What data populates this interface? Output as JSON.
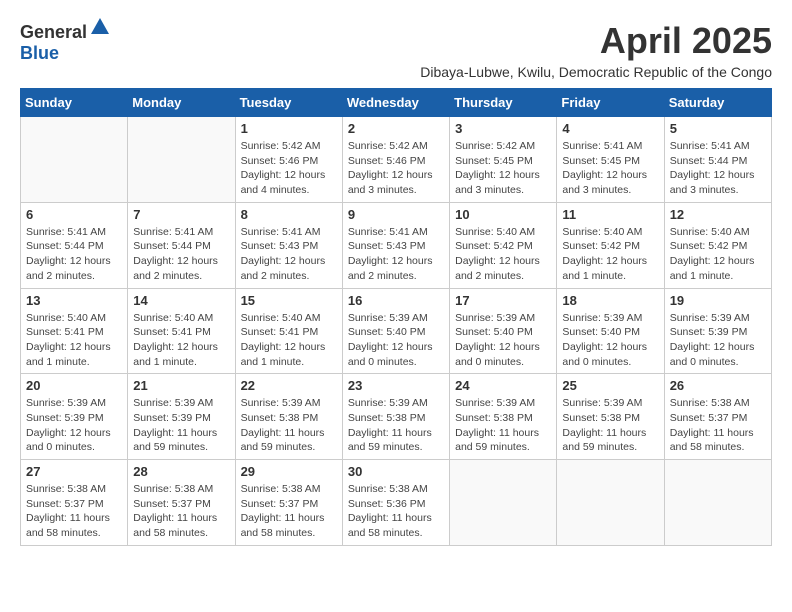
{
  "logo": {
    "general": "General",
    "blue": "Blue"
  },
  "title": {
    "month_year": "April 2025",
    "location": "Dibaya-Lubwe, Kwilu, Democratic Republic of the Congo"
  },
  "header_days": [
    "Sunday",
    "Monday",
    "Tuesday",
    "Wednesday",
    "Thursday",
    "Friday",
    "Saturday"
  ],
  "weeks": [
    [
      {
        "day": "",
        "info": ""
      },
      {
        "day": "",
        "info": ""
      },
      {
        "day": "1",
        "info": "Sunrise: 5:42 AM\nSunset: 5:46 PM\nDaylight: 12 hours\nand 4 minutes."
      },
      {
        "day": "2",
        "info": "Sunrise: 5:42 AM\nSunset: 5:46 PM\nDaylight: 12 hours\nand 3 minutes."
      },
      {
        "day": "3",
        "info": "Sunrise: 5:42 AM\nSunset: 5:45 PM\nDaylight: 12 hours\nand 3 minutes."
      },
      {
        "day": "4",
        "info": "Sunrise: 5:41 AM\nSunset: 5:45 PM\nDaylight: 12 hours\nand 3 minutes."
      },
      {
        "day": "5",
        "info": "Sunrise: 5:41 AM\nSunset: 5:44 PM\nDaylight: 12 hours\nand 3 minutes."
      }
    ],
    [
      {
        "day": "6",
        "info": "Sunrise: 5:41 AM\nSunset: 5:44 PM\nDaylight: 12 hours\nand 2 minutes."
      },
      {
        "day": "7",
        "info": "Sunrise: 5:41 AM\nSunset: 5:44 PM\nDaylight: 12 hours\nand 2 minutes."
      },
      {
        "day": "8",
        "info": "Sunrise: 5:41 AM\nSunset: 5:43 PM\nDaylight: 12 hours\nand 2 minutes."
      },
      {
        "day": "9",
        "info": "Sunrise: 5:41 AM\nSunset: 5:43 PM\nDaylight: 12 hours\nand 2 minutes."
      },
      {
        "day": "10",
        "info": "Sunrise: 5:40 AM\nSunset: 5:42 PM\nDaylight: 12 hours\nand 2 minutes."
      },
      {
        "day": "11",
        "info": "Sunrise: 5:40 AM\nSunset: 5:42 PM\nDaylight: 12 hours\nand 1 minute."
      },
      {
        "day": "12",
        "info": "Sunrise: 5:40 AM\nSunset: 5:42 PM\nDaylight: 12 hours\nand 1 minute."
      }
    ],
    [
      {
        "day": "13",
        "info": "Sunrise: 5:40 AM\nSunset: 5:41 PM\nDaylight: 12 hours\nand 1 minute."
      },
      {
        "day": "14",
        "info": "Sunrise: 5:40 AM\nSunset: 5:41 PM\nDaylight: 12 hours\nand 1 minute."
      },
      {
        "day": "15",
        "info": "Sunrise: 5:40 AM\nSunset: 5:41 PM\nDaylight: 12 hours\nand 1 minute."
      },
      {
        "day": "16",
        "info": "Sunrise: 5:39 AM\nSunset: 5:40 PM\nDaylight: 12 hours\nand 0 minutes."
      },
      {
        "day": "17",
        "info": "Sunrise: 5:39 AM\nSunset: 5:40 PM\nDaylight: 12 hours\nand 0 minutes."
      },
      {
        "day": "18",
        "info": "Sunrise: 5:39 AM\nSunset: 5:40 PM\nDaylight: 12 hours\nand 0 minutes."
      },
      {
        "day": "19",
        "info": "Sunrise: 5:39 AM\nSunset: 5:39 PM\nDaylight: 12 hours\nand 0 minutes."
      }
    ],
    [
      {
        "day": "20",
        "info": "Sunrise: 5:39 AM\nSunset: 5:39 PM\nDaylight: 12 hours\nand 0 minutes."
      },
      {
        "day": "21",
        "info": "Sunrise: 5:39 AM\nSunset: 5:39 PM\nDaylight: 11 hours\nand 59 minutes."
      },
      {
        "day": "22",
        "info": "Sunrise: 5:39 AM\nSunset: 5:38 PM\nDaylight: 11 hours\nand 59 minutes."
      },
      {
        "day": "23",
        "info": "Sunrise: 5:39 AM\nSunset: 5:38 PM\nDaylight: 11 hours\nand 59 minutes."
      },
      {
        "day": "24",
        "info": "Sunrise: 5:39 AM\nSunset: 5:38 PM\nDaylight: 11 hours\nand 59 minutes."
      },
      {
        "day": "25",
        "info": "Sunrise: 5:39 AM\nSunset: 5:38 PM\nDaylight: 11 hours\nand 59 minutes."
      },
      {
        "day": "26",
        "info": "Sunrise: 5:38 AM\nSunset: 5:37 PM\nDaylight: 11 hours\nand 58 minutes."
      }
    ],
    [
      {
        "day": "27",
        "info": "Sunrise: 5:38 AM\nSunset: 5:37 PM\nDaylight: 11 hours\nand 58 minutes."
      },
      {
        "day": "28",
        "info": "Sunrise: 5:38 AM\nSunset: 5:37 PM\nDaylight: 11 hours\nand 58 minutes."
      },
      {
        "day": "29",
        "info": "Sunrise: 5:38 AM\nSunset: 5:37 PM\nDaylight: 11 hours\nand 58 minutes."
      },
      {
        "day": "30",
        "info": "Sunrise: 5:38 AM\nSunset: 5:36 PM\nDaylight: 11 hours\nand 58 minutes."
      },
      {
        "day": "",
        "info": ""
      },
      {
        "day": "",
        "info": ""
      },
      {
        "day": "",
        "info": ""
      }
    ]
  ]
}
